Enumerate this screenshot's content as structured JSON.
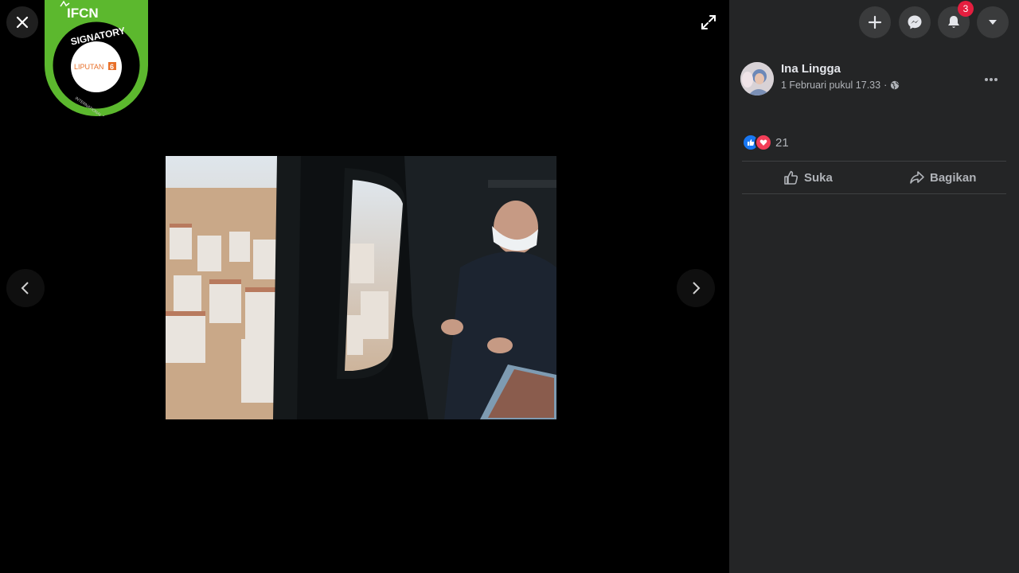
{
  "post": {
    "author": "Ina Lingga",
    "timestamp": "1 Februari pukul 17.33",
    "privacy_icon": "globe-icon",
    "reaction_count": "21",
    "reactions": [
      "like-icon",
      "love-icon"
    ]
  },
  "actions": {
    "like_label": "Suka",
    "share_label": "Bagikan"
  },
  "header": {
    "notification_count": "3"
  },
  "badge": {
    "line1": "IFCN",
    "line2": "SIGNATORY",
    "line3": "LIPUTAN",
    "line4": "6",
    "arc": "INTERNATIONAL FACT-CHECKING NETWORK"
  },
  "colors": {
    "sidebar_bg": "#242526",
    "badge_green": "#5cb82e",
    "like_blue": "#1877f2",
    "love_red": "#f33e58",
    "notif_red": "#e41e3f"
  }
}
